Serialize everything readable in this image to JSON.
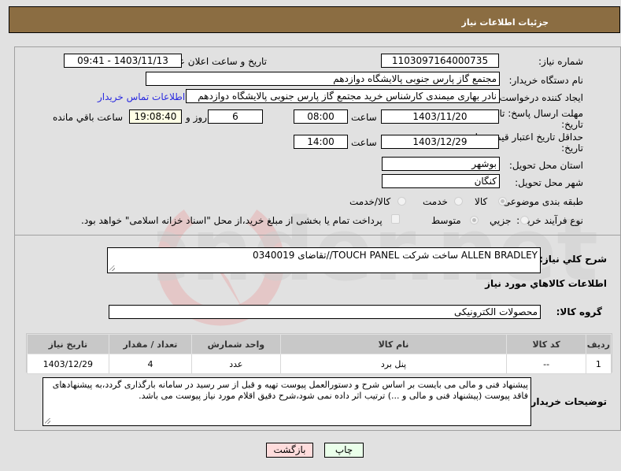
{
  "header": {
    "title": "جزئیات اطلاعات نیاز"
  },
  "fields": {
    "need_number": {
      "label": "شماره نیاز:",
      "value": "1103097164000735"
    },
    "announce_datetime": {
      "label": "تاریخ و ساعت اعلان عمومی:",
      "value": "1403/11/13 - 09:41"
    },
    "buyer_org": {
      "label": "نام دستگاه خریدار:",
      "value": "مجتمع گاز پارس جنوبی  پالایشگاه دوازدهم"
    },
    "requester": {
      "label": "ایجاد کننده درخواست:",
      "value": "نادر بهاری میمندی کارشناس خرید مجتمع گاز پارس جنوبی  پالایشگاه دوازدهم",
      "contact_link": "اطلاعات تماس خریدار"
    },
    "response_deadline": {
      "label_line1": "مهلت ارسال پاسخ: تا",
      "label_line2": "تاریخ:",
      "date": "1403/11/20",
      "time_label": "ساعت",
      "time": "08:00",
      "days": "6",
      "days_label": "روز و",
      "remaining": "19:08:40",
      "remaining_label": "ساعت باقي مانده"
    },
    "price_validity": {
      "label_line1": "حداقل تاریخ اعتبار قیمت: تا",
      "label_line2": "تاریخ:",
      "date": "1403/12/29",
      "time_label": "ساعت",
      "time": "14:00"
    },
    "delivery_province": {
      "label": "استان محل تحویل:",
      "value": "بوشهر"
    },
    "delivery_city": {
      "label": "شهر محل تحویل:",
      "value": "کنگان"
    },
    "category": {
      "label": "طبقه بندی موضوعی:",
      "options": [
        "کالا",
        "خدمت",
        "کالا/خدمت"
      ],
      "selected": "کالا"
    },
    "purchase_process": {
      "label": "نوع فرآیند خرید :",
      "options": [
        "جزیي",
        "متوسط"
      ],
      "selected": "متوسط",
      "treasury_checkbox_label": "پرداخت تمام یا بخشی از مبلغ خرید،از محل \"اسناد خزانه اسلامی\" خواهد بود.",
      "treasury_checked": false
    }
  },
  "description": {
    "label": "شرح کلي نياز:",
    "value": "ALLEN BRADLEY ساخت شرکت TOUCH PANEL//تقاضای 0340019"
  },
  "goods_section": {
    "title": "اطلاعات کالاهاي مورد نياز",
    "group_label": "گروه کالا:",
    "group_value": "محصولات الکترونیکی"
  },
  "table": {
    "headers": [
      "ردیف",
      "کد کالا",
      "نام کالا",
      "واحد شمارش",
      "تعداد / مقدار",
      "تاریخ نیاز"
    ],
    "rows": [
      [
        "1",
        "--",
        "پنل برد",
        "عدد",
        "4",
        "1403/12/29"
      ]
    ]
  },
  "buyer_notes": {
    "label": "توضیحات خریدار:",
    "value": "پیشنهاد فنی و مالی می بایست بر اساس شرح و دستورالعمل پیوست تهیه و قبل از سر رسید در سامانه بارگذاری گردد،به پیشنهادهای فاقد پیوست (پیشنهاد فنی و مالی و ...) ترتیب اثر داده نمی شود،شرح دقیق اقلام مورد نیاز پیوست می باشد."
  },
  "buttons": {
    "print": "چاپ",
    "back": "بازگشت"
  },
  "colors": {
    "header_bg": "#8b6d42",
    "link": "#2a2ae0",
    "print_bg": "#eaffea",
    "back_bg": "#ffdcdc",
    "remaining_bg": "#ffffe6"
  }
}
